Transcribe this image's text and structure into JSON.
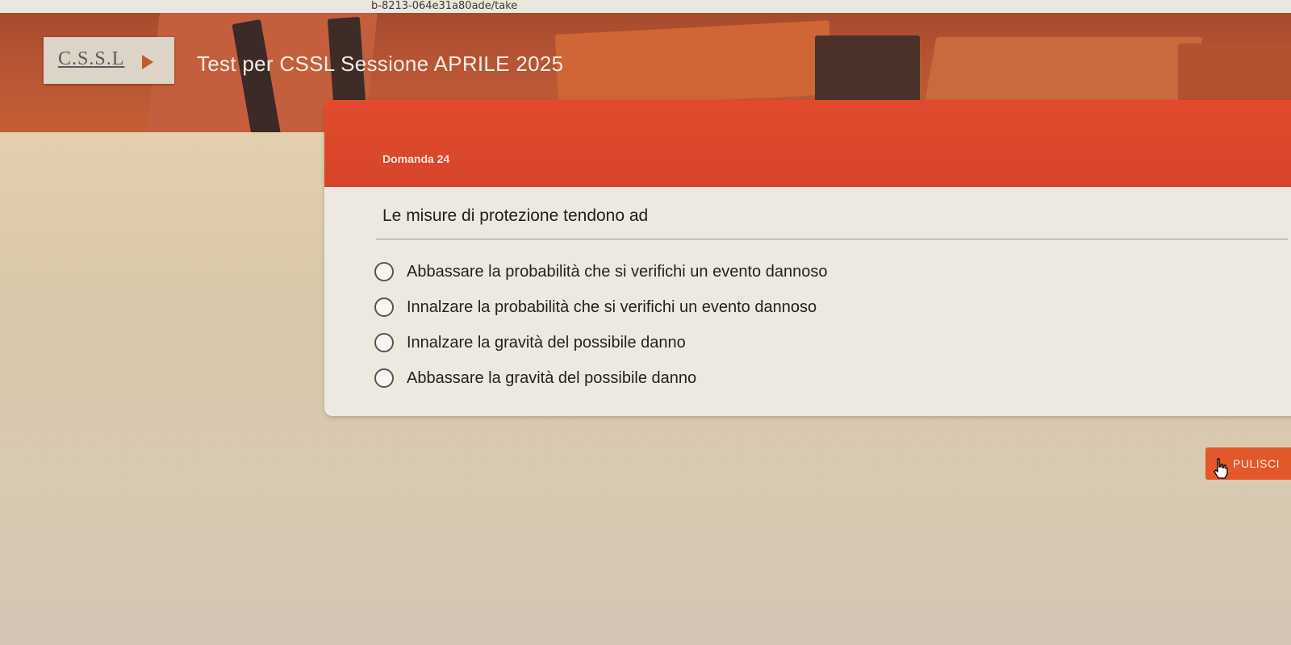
{
  "browser": {
    "url_fragment": "b-8213-064e31a80ade/take"
  },
  "header": {
    "logo_text": "C.S.S.L",
    "title": "Test per CSSL Sessione APRILE 2025"
  },
  "question": {
    "number_label": "Domanda 24",
    "text": "Le misure di protezione tendono ad",
    "options": [
      "Abbassare la probabilità che si verifichi un evento dannoso",
      "Innalzare la probabilità che si verifichi un evento dannoso",
      "Innalzare la gravità del possibile danno",
      "Abbassare la gravità del possibile danno"
    ],
    "selected": null
  },
  "actions": {
    "clear_label": "PULISCI"
  },
  "icons": {
    "cursor": "hand-pointer-icon",
    "logo_arrow": "play-arrow-icon",
    "option_radio": "radio-empty-icon"
  },
  "colors": {
    "accent": "#e24a2c",
    "header_bg": "#b65434",
    "card_bg": "#ede9e1",
    "page_bg": "#e2cfae",
    "button": "#e2582b"
  }
}
